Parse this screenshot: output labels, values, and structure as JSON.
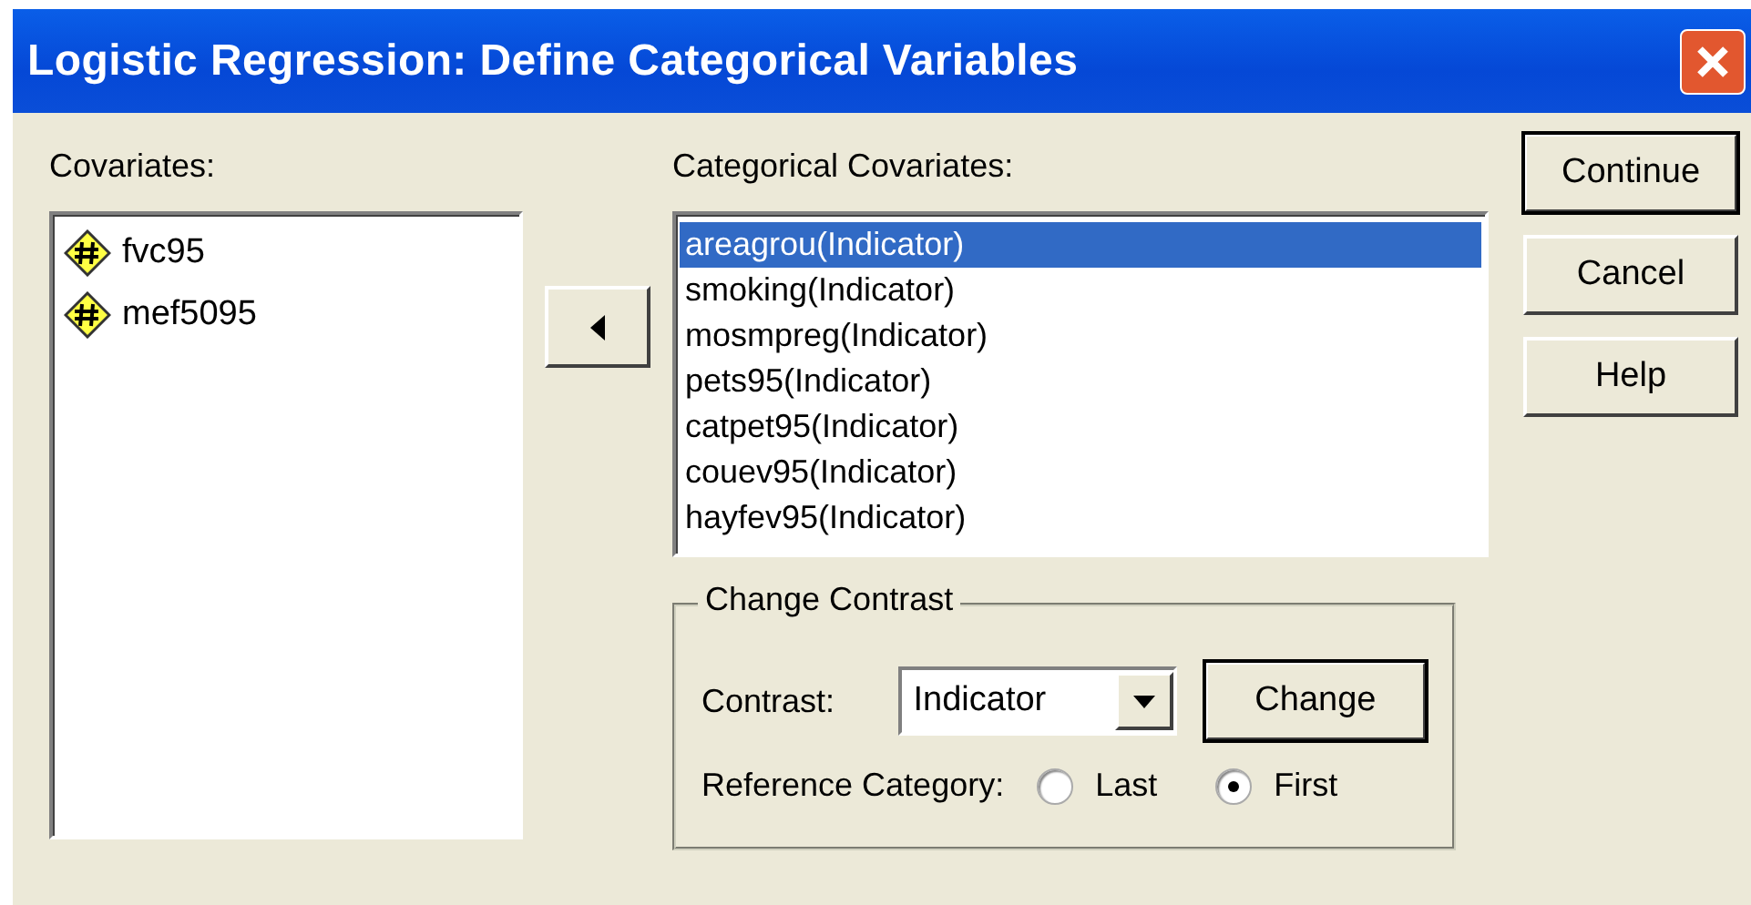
{
  "window": {
    "title": "Logistic Regression: Define Categorical Variables"
  },
  "covariates": {
    "label": "Covariates:",
    "items": [
      {
        "name": "fvc95"
      },
      {
        "name": "mef5095"
      }
    ]
  },
  "categorical": {
    "label": "Categorical Covariates:",
    "items": [
      {
        "name": "areagrou(Indicator)",
        "selected": true
      },
      {
        "name": "smoking(Indicator)",
        "selected": false
      },
      {
        "name": "mosmpreg(Indicator)",
        "selected": false
      },
      {
        "name": "pets95(Indicator)",
        "selected": false
      },
      {
        "name": "catpet95(Indicator)",
        "selected": false
      },
      {
        "name": "couev95(Indicator)",
        "selected": false
      },
      {
        "name": "hayfev95(Indicator)",
        "selected": false
      }
    ]
  },
  "change_contrast": {
    "legend": "Change Contrast",
    "contrast_label": "Contrast:",
    "contrast_value": "Indicator",
    "change_button": "Change",
    "reference_label": "Reference Category:",
    "options": [
      {
        "label": "Last",
        "selected": false
      },
      {
        "label": "First",
        "selected": true
      }
    ]
  },
  "buttons": [
    {
      "label": "Continue",
      "default": true
    },
    {
      "label": "Cancel",
      "default": false
    },
    {
      "label": "Help",
      "default": false
    }
  ]
}
